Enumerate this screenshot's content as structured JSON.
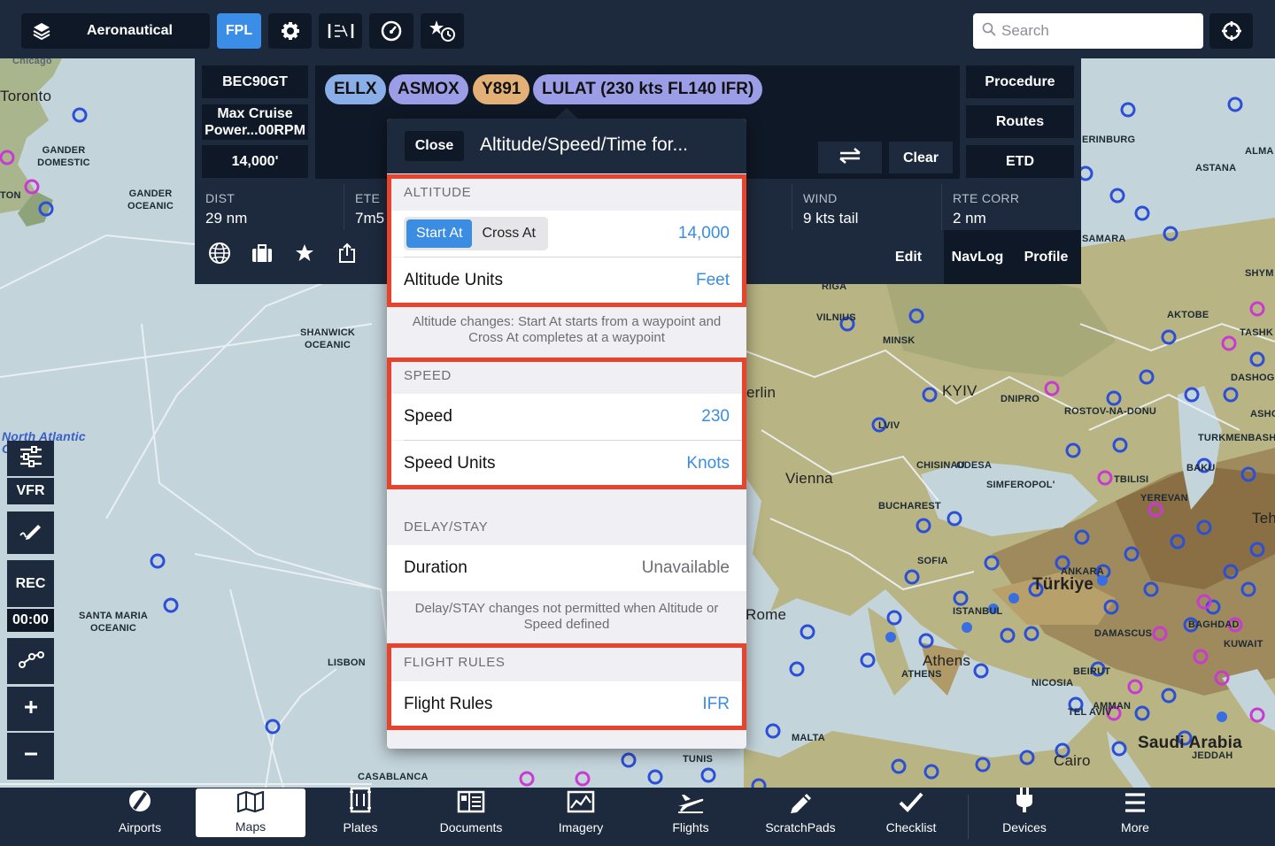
{
  "topbar": {
    "layers_label": "Aeronautical",
    "fpl_label": "FPL",
    "search_placeholder": "Search"
  },
  "fpl": {
    "aircraft": "BEC90GT",
    "power": "Max Cruise Power...00RPM",
    "altitude": "14,000'",
    "route_pills": [
      {
        "label": "ELLX",
        "color": "#8aaee8"
      },
      {
        "label": "ASMOX",
        "color": "#9b9ee6"
      },
      {
        "label": "Y891",
        "color": "#e3b077"
      },
      {
        "label": "LULAT (230 kts FL140 IFR)",
        "color": "#9b9ee6"
      }
    ],
    "procedure": "Procedure",
    "routes": "Routes",
    "etd": "ETD",
    "clear": "Clear",
    "stats": {
      "dist_label": "DIST",
      "dist_value": "29 nm",
      "ete_label": "ETE",
      "ete_value": "7m5",
      "wind_label": "WIND",
      "wind_value": "9 kts tail",
      "rtecorr_label": "RTE CORR",
      "rtecorr_value": "2 nm"
    },
    "edit": "Edit",
    "navlog": "NavLog",
    "profile": "Profile"
  },
  "popover": {
    "close_label": "Close",
    "title": "Altitude/Speed/Time for...",
    "altitude_header": "ALTITUDE",
    "start_at": "Start At",
    "cross_at": "Cross At",
    "altitude_value": "14,000",
    "altitude_units_label": "Altitude Units",
    "altitude_units_value": "Feet",
    "altitude_note": "Altitude changes: Start At starts from a waypoint and Cross At completes at a waypoint",
    "speed_header": "SPEED",
    "speed_label": "Speed",
    "speed_value": "230",
    "speed_units_label": "Speed Units",
    "speed_units_value": "Knots",
    "delay_header": "DELAY/STAY",
    "duration_label": "Duration",
    "duration_value": "Unavailable",
    "delay_note": "Delay/STAY changes not permitted when Altitude or Speed defined",
    "rules_header": "FLIGHT RULES",
    "rules_label": "Flight Rules",
    "rules_value": "IFR"
  },
  "left_tools": {
    "vfr": "VFR",
    "rec": "REC",
    "timer": "00:00"
  },
  "map_labels": {
    "chicago": "Chicago",
    "toronto": "Toronto",
    "gander_domestic": "GANDER DOMESTIC",
    "gander_oceanic": "GANDER OCEANIC",
    "shanwick": "SHANWICK OCEANIC",
    "north_atlantic": "North Atlantic Ocean",
    "santa_maria": "SANTA MARIA OCEANIC",
    "lisbon": "LISBON",
    "casablanca": "CASABLANCA",
    "riga": "RIGA",
    "vilnius": "VILNIUS",
    "minsk": "MINSK",
    "kyiv": "KYIV",
    "dnipro": "DNIPRO",
    "rostov": "ROSTOV-NA-DONU",
    "lviv": "LVIV",
    "chisinau": "CHISINAU",
    "odesa": "ODESA",
    "simferopol": "SIMFEROPOL'",
    "vienna": "Vienna",
    "berlin": "erlin",
    "bucharest": "BUCHAREST",
    "sofia": "SOFIA",
    "istanbul": "ISTANBUL",
    "turkiye": "Türkiye",
    "ankara": "ANKARA",
    "athens": "Athens",
    "athens_caps": "ATHENS",
    "rome": "Rome",
    "malta": "MALTA",
    "tunis": "TUNIS",
    "nicosia": "NICOSIA",
    "beirut": "BEIRUT",
    "damascus": "DAMASCUS",
    "amman": "AMMAN",
    "tel_aviv": "TEL AVIV",
    "baghdad": "BAGHDAD",
    "kuwait": "KUWAIT",
    "cairo": "Cairo",
    "saudi": "Saudi Arabia",
    "jeddah": "JEDDAH",
    "tbilisi": "TBILISI",
    "yerevan": "YEREVAN",
    "baku": "BAKU",
    "turkmenbashi": "TURKMENBASHI",
    "astana": "ASTANA",
    "yekaterinburg": "ERINBURG",
    "samara": "SAMARA",
    "aktobe": "AKTOBE",
    "tashkent": "TASHK",
    "almaty": "ALMA",
    "shym": "SHYM",
    "dashog": "DASHOG",
    "ashg": "ASHG",
    "tehran": "Teh",
    "ton": "TON"
  },
  "tabs": [
    {
      "label": "Airports",
      "icon": "airport-icon"
    },
    {
      "label": "Maps",
      "icon": "map-icon"
    },
    {
      "label": "Plates",
      "icon": "plates-icon"
    },
    {
      "label": "Documents",
      "icon": "documents-icon"
    },
    {
      "label": "Imagery",
      "icon": "imagery-icon"
    },
    {
      "label": "Flights",
      "icon": "plane-icon"
    },
    {
      "label": "ScratchPads",
      "icon": "pencil-icon"
    },
    {
      "label": "Checklist",
      "icon": "checkmark-icon"
    },
    {
      "label": "Devices",
      "icon": "plug-icon"
    },
    {
      "label": "More",
      "icon": "menu-icon"
    }
  ],
  "colors": {
    "chrome": "#1d2a3d",
    "chrome_dark": "#0f1826",
    "accent": "#3b8ee8",
    "highlight": "#e8442d"
  }
}
